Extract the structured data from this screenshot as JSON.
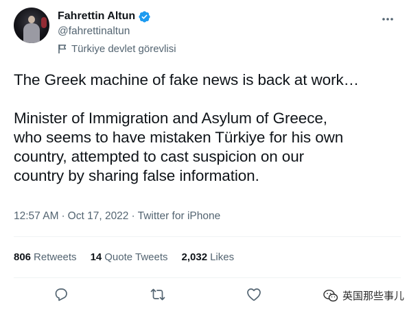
{
  "user": {
    "display_name": "Fahrettin Altun",
    "handle": "@fahrettinaltun",
    "label": "Türkiye devlet görevlisi",
    "verified": true,
    "verified_color": "#1d9bf0"
  },
  "tweet": {
    "paragraphs": [
      "The Greek machine of fake news is back at work…",
      "Minister of Immigration and Asylum of Greece,\nwho seems to have mistaken Türkiye for his own\ncountry, attempted to cast suspicion on our\ncountry by sharing false information."
    ],
    "time": "12:57 AM",
    "date": "Oct 17, 2022",
    "source": "Twitter for iPhone",
    "separator": "·"
  },
  "stats": {
    "retweets_count": "806",
    "retweets_label": "Retweets",
    "quotes_count": "14",
    "quotes_label": "Quote Tweets",
    "likes_count": "2,032",
    "likes_label": "Likes"
  },
  "actions": {
    "icons": [
      "reply-icon",
      "retweet-icon",
      "like-icon",
      "share-icon"
    ]
  },
  "watermark": {
    "text": "英国那些事儿"
  },
  "colors": {
    "text_primary": "#0f1419",
    "text_secondary": "#536471",
    "divider": "#eff3f4",
    "accent": "#1d9bf0"
  }
}
